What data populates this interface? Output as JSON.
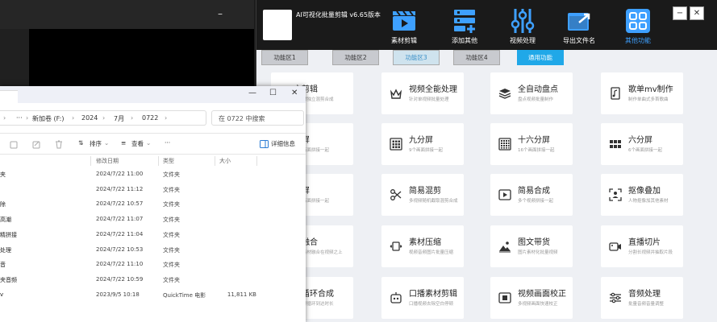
{
  "dark_window": {
    "min_glyph": "–"
  },
  "app": {
    "title": "AI可视化批量剪辑 v6.65版本",
    "tools": [
      {
        "label": "素材剪辑",
        "icon": "clapperboard-icon"
      },
      {
        "label": "添加其他",
        "icon": "add-layers-icon"
      },
      {
        "label": "视频处理",
        "icon": "sliders-icon"
      },
      {
        "label": "导出文件名",
        "icon": "export-folder-icon"
      },
      {
        "label": "其他功能",
        "icon": "grid-apps-icon"
      }
    ],
    "win_min": "−",
    "win_close": "✕",
    "tabs": [
      "功能区1",
      "功能区2",
      "功能区3",
      "功能区4",
      "通用功能"
    ],
    "cards": [
      {
        "title": "立剪辑",
        "sub": "多素材独立混剪合成"
      },
      {
        "title": "视频全能处理",
        "sub": "针对单视频批量处理"
      },
      {
        "title": "全自动盘点",
        "sub": "盘点视频批量制作"
      },
      {
        "title": "歌单mv制作",
        "sub": "制作单曲式多首歌曲"
      },
      {
        "title": "分屏",
        "sub": "两个画面拼接一起"
      },
      {
        "title": "九分屏",
        "sub": "9个画面拼接一起"
      },
      {
        "title": "十六分屏",
        "sub": "16个画面拼接一起"
      },
      {
        "title": "六分屏",
        "sub": "6个画面拼接一起"
      },
      {
        "title": "分屏",
        "sub": "两个画面拼接一起"
      },
      {
        "title": "简易混剪",
        "sub": "多视频随机截取混剪合成"
      },
      {
        "title": "简易合成",
        "sub": "多个视频拼接一起"
      },
      {
        "title": "抠像叠加",
        "sub": "人物抠像加其他素材"
      },
      {
        "title": "化融合",
        "sub": "视频素材融合在视频之上"
      },
      {
        "title": "素材压缩",
        "sub": "视频音频图片批量压缩"
      },
      {
        "title": "图文带货",
        "sub": "图片素材化批量视频"
      },
      {
        "title": "直播切片",
        "sub": "分割长视频并抽取片段"
      },
      {
        "title": "频循环合成",
        "sub": "多视频循环到达时长"
      },
      {
        "title": "口播素材剪辑",
        "sub": "口播视频去除空白停顿"
      },
      {
        "title": "视频画面校正",
        "sub": "多视频画面快速校正"
      },
      {
        "title": "音频处理",
        "sub": "批量音频音量调整"
      }
    ]
  },
  "explorer": {
    "win_min": "—",
    "win_max": "☐",
    "win_close": "✕",
    "ellipsis": "···",
    "breadcrumbs": [
      "新加卷 (F:)",
      "2024",
      "7月",
      "0722"
    ],
    "search_placeholder": "在 0722 中搜索",
    "toolbar": {
      "sort": "排序",
      "view": "查看",
      "more": "···",
      "details": "详细信息"
    },
    "columns": {
      "date": "修改日期",
      "type": "类型",
      "size": "大小"
    },
    "rows": [
      {
        "name": "夹",
        "date": "2024/7/22 11:00",
        "type": "文件夹",
        "size": ""
      },
      {
        "name": "",
        "date": "2024/7/22 11:12",
        "type": "文件夹",
        "size": ""
      },
      {
        "name": "除",
        "date": "2024/7/22 10:57",
        "type": "文件夹",
        "size": ""
      },
      {
        "name": "高潮",
        "date": "2024/7/22 11:07",
        "type": "文件夹",
        "size": ""
      },
      {
        "name": "精拼接",
        "date": "2024/7/22 11:04",
        "type": "文件夹",
        "size": ""
      },
      {
        "name": "处理",
        "date": "2024/7/22 10:53",
        "type": "文件夹",
        "size": ""
      },
      {
        "name": "音",
        "date": "2024/7/22 11:10",
        "type": "文件夹",
        "size": ""
      },
      {
        "name": "夹音频",
        "date": "2024/7/22 10:59",
        "type": "文件夹",
        "size": ""
      },
      {
        "name": "v",
        "date": "2023/9/5 10:18",
        "type": "QuickTime 电影",
        "size": "11,811 KB"
      }
    ]
  }
}
